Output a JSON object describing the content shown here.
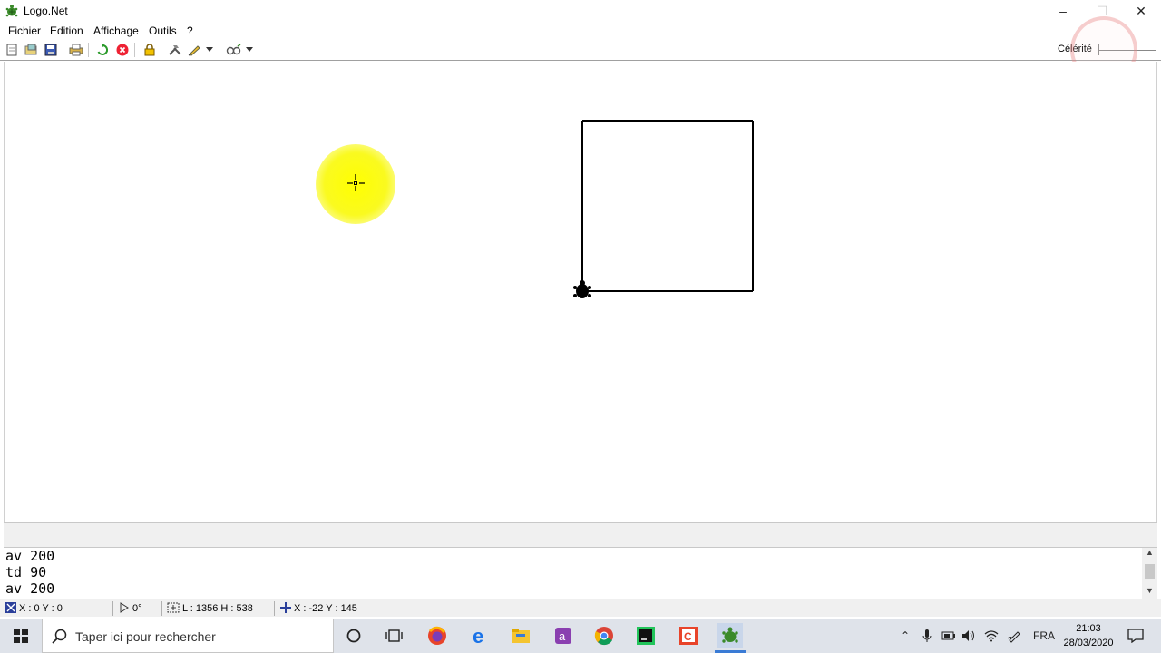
{
  "window": {
    "title": "Logo.Net"
  },
  "menu": {
    "items": [
      "Fichier",
      "Edition",
      "Affichage",
      "Outils",
      "?"
    ]
  },
  "toolbar": {
    "buttons": [
      "new-file-icon",
      "open-file-icon",
      "save-icon",
      "print-icon",
      "refresh-icon",
      "stop-icon",
      "lock-icon",
      "tools-icon",
      "pen-icon",
      "turtle-view-icon"
    ],
    "speed_label": "Célérité"
  },
  "canvas": {
    "square_side": 200,
    "turtle_heading_deg": 0
  },
  "console": {
    "lines": [
      "av 200",
      "td 90",
      "av 200"
    ]
  },
  "status": {
    "turtle_pos": "X : 0   Y : 0",
    "heading": "0°",
    "canvas_size": "L : 1356   H : 538",
    "mouse_pos": "X : -22   Y : 145"
  },
  "taskbar": {
    "search_placeholder": "Taper ici pour rechercher",
    "apps": [
      "cortana-icon",
      "task-view-icon",
      "firefox-icon",
      "edge-icon",
      "file-explorer-icon",
      "office-icon",
      "chrome-icon",
      "pycharm-icon",
      "app-c-icon",
      "logo-net-icon"
    ],
    "language": "FRA",
    "time": "21:03",
    "date": "28/03/2020"
  }
}
